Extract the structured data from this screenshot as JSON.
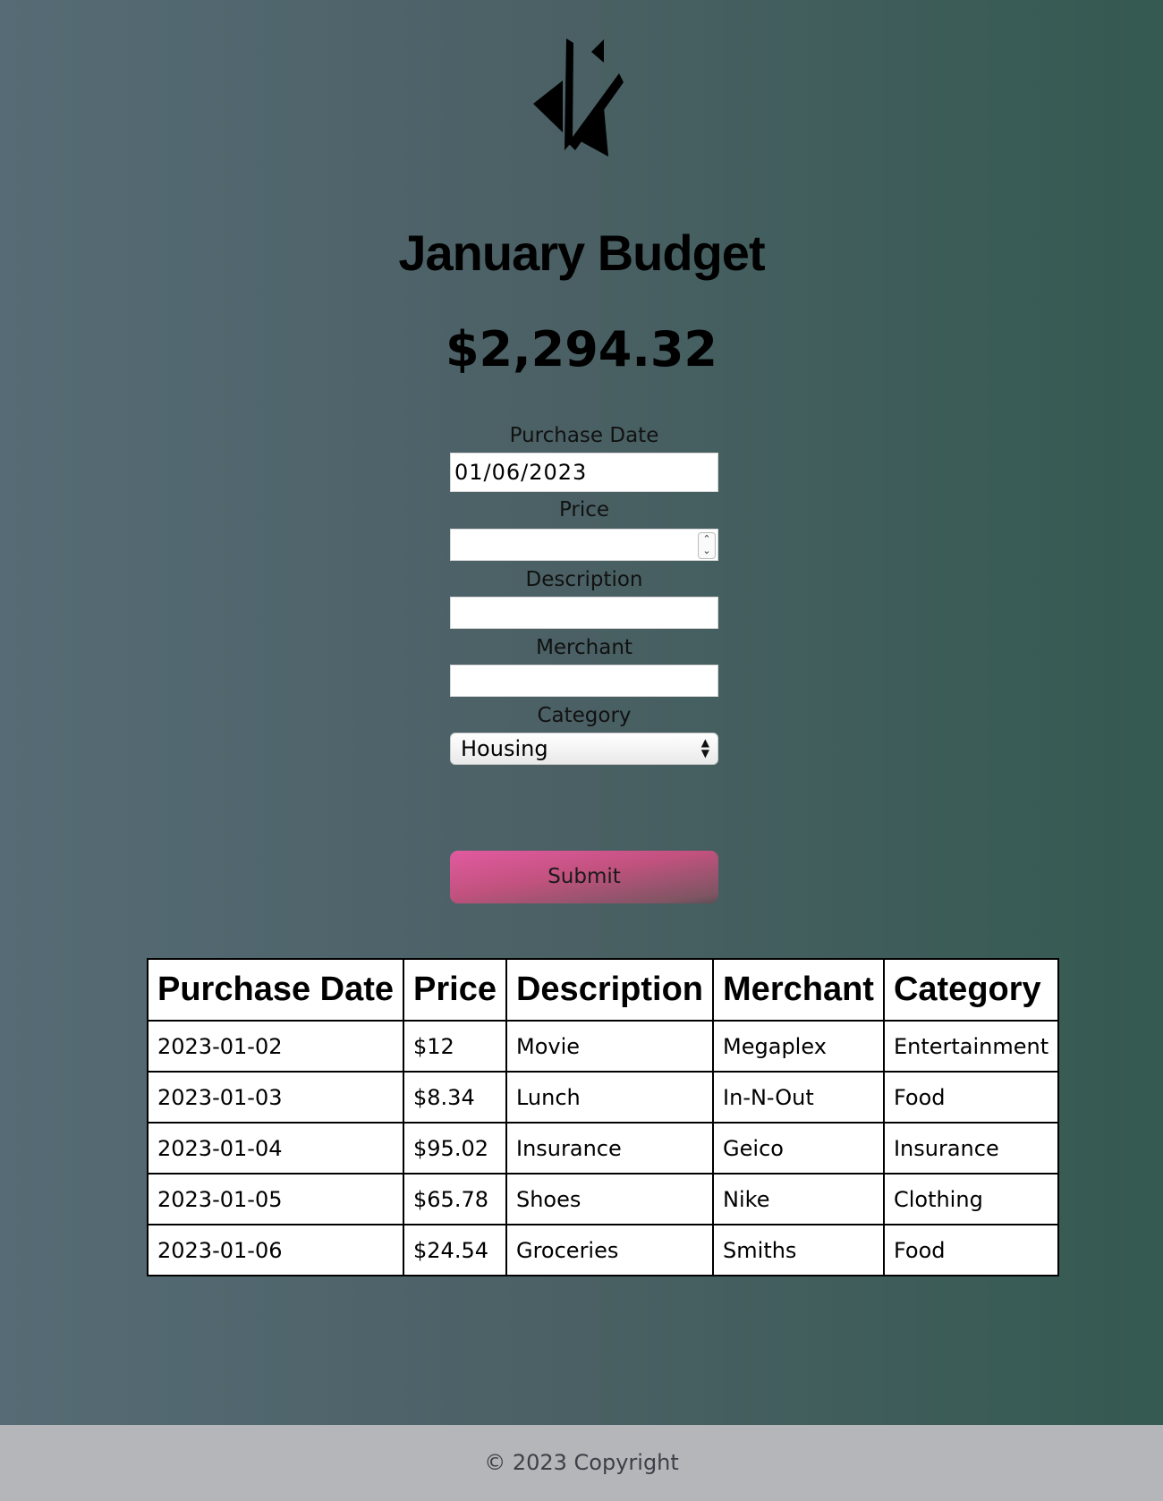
{
  "page": {
    "logo_icon": "stylized-lightning-logo",
    "title": "January Budget",
    "total": "$2,294.32"
  },
  "form": {
    "purchase_date_label": "Purchase Date",
    "purchase_date_value": "01/06/2023",
    "price_label": "Price",
    "price_value": "",
    "description_label": "Description",
    "description_value": "",
    "merchant_label": "Merchant",
    "merchant_value": "",
    "category_label": "Category",
    "category_selected": "Housing",
    "submit_label": "Submit"
  },
  "table": {
    "headers": [
      "Purchase Date",
      "Price",
      "Description",
      "Merchant",
      "Category"
    ],
    "rows": [
      [
        "2023-01-02",
        "$12",
        "Movie",
        "Megaplex",
        "Entertainment"
      ],
      [
        "2023-01-03",
        "$8.34",
        "Lunch",
        "In-N-Out",
        "Food"
      ],
      [
        "2023-01-04",
        "$95.02",
        "Insurance",
        "Geico",
        "Insurance"
      ],
      [
        "2023-01-05",
        "$65.78",
        "Shoes",
        "Nike",
        "Clothing"
      ],
      [
        "2023-01-06",
        "$24.54",
        "Groceries",
        "Smiths",
        "Food"
      ]
    ]
  },
  "footer": {
    "text": "© 2023 Copyright"
  },
  "colors": {
    "background_left": "#566b75",
    "background_right": "#345a51",
    "submit_accent": "#e25aa0",
    "footer_bg": "#b4b6b9"
  }
}
